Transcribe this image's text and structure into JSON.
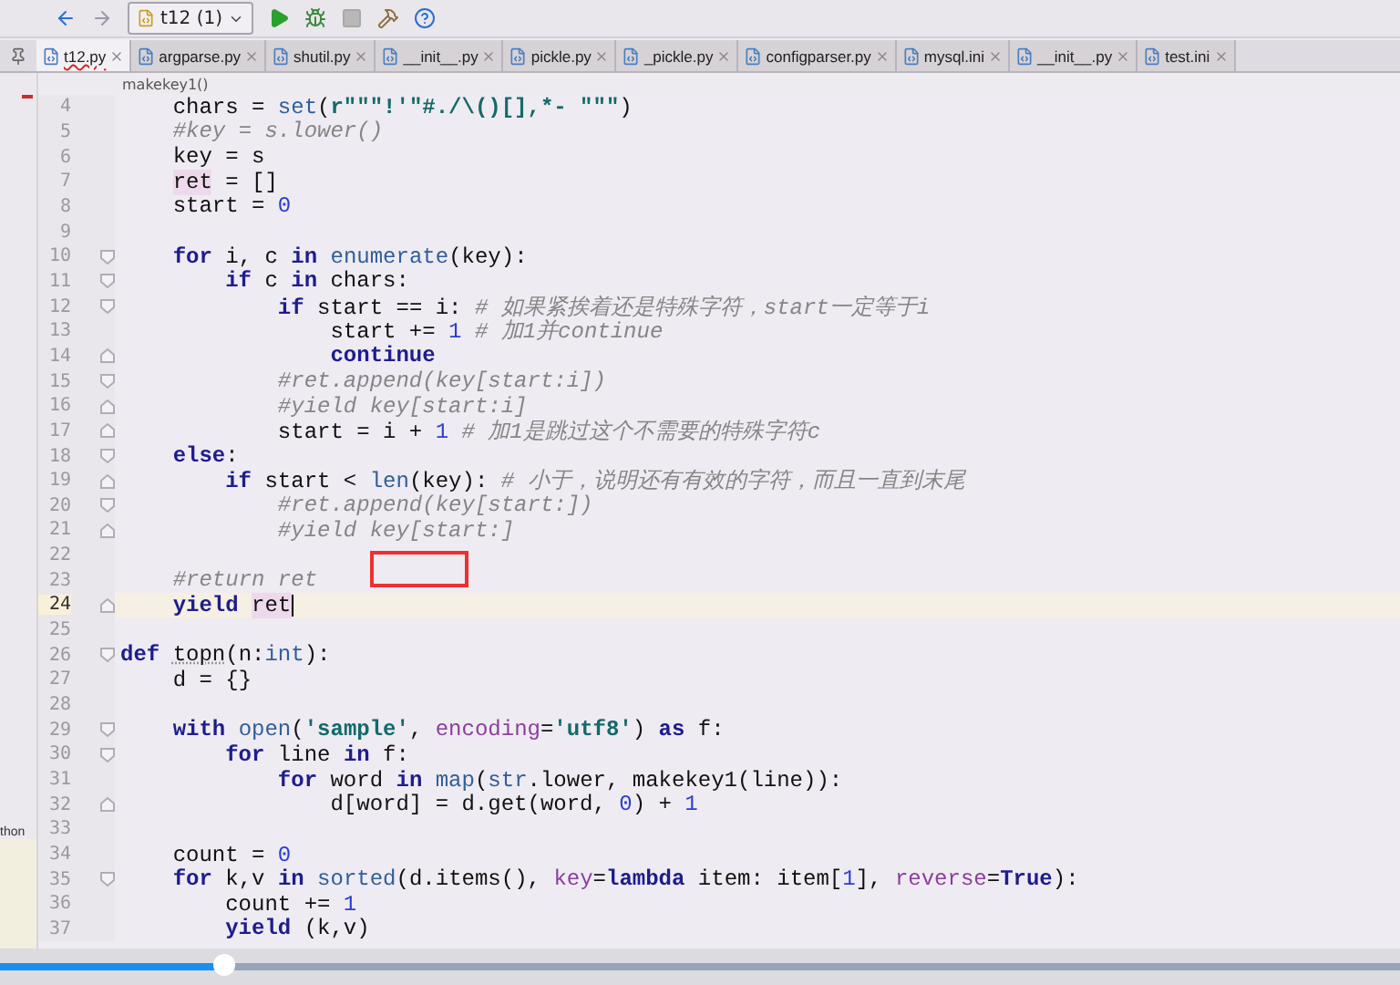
{
  "toolbar": {
    "run_config": "t12 (1)"
  },
  "tabs": [
    {
      "label": "t12.py",
      "selected": true,
      "error": true
    },
    {
      "label": "argparse.py",
      "selected": false,
      "error": false
    },
    {
      "label": "shutil.py",
      "selected": false,
      "error": false
    },
    {
      "label": "__init__.py",
      "selected": false,
      "error": false
    },
    {
      "label": "pickle.py",
      "selected": false,
      "error": false
    },
    {
      "label": "_pickle.py",
      "selected": false,
      "error": false
    },
    {
      "label": "configparser.py",
      "selected": false,
      "error": false
    },
    {
      "label": "mysql.ini",
      "selected": false,
      "error": false
    },
    {
      "label": "__init__.py",
      "selected": false,
      "error": false
    },
    {
      "label": "test.ini",
      "selected": false,
      "error": false
    }
  ],
  "breadcrumb": "makekey1()",
  "side_panel_fragment": "thon",
  "lines": [
    {
      "number": "4",
      "kind": "plain",
      "current": false,
      "tokens": [
        {
          "kind": "plain",
          "text": "    chars = "
        },
        {
          "kind": "builtin",
          "text": "set"
        },
        {
          "kind": "plain",
          "text": "("
        },
        {
          "kind": "str",
          "text": "r\"\"\"!'\"#./\\()[],*- \"\"\""
        },
        {
          "kind": "plain",
          "text": ")"
        }
      ]
    },
    {
      "number": "5",
      "kind": "plain",
      "current": false,
      "tokens": [
        {
          "kind": "cmt",
          "text": "    #key = s.lower()"
        }
      ]
    },
    {
      "number": "6",
      "kind": "plain",
      "current": false,
      "tokens": [
        {
          "kind": "plain",
          "text": "    key = s"
        }
      ]
    },
    {
      "number": "7",
      "kind": "plain",
      "current": false,
      "tokens": [
        {
          "kind": "ref",
          "text": "    ret"
        },
        {
          "kind": "plain",
          "text": " = []"
        }
      ]
    },
    {
      "number": "8",
      "kind": "plain",
      "current": false,
      "tokens": [
        {
          "kind": "plain",
          "text": "    start = "
        },
        {
          "kind": "num",
          "text": "0"
        }
      ]
    },
    {
      "number": "9",
      "kind": "plain",
      "current": false
    },
    {
      "number": "10",
      "kind": "fold-start",
      "current": false,
      "tokens": [
        {
          "kind": "kw",
          "text": "    for"
        },
        {
          "kind": "plain",
          "text": " i, c "
        },
        {
          "kind": "kw",
          "text": "in"
        },
        {
          "kind": "builtin",
          "text": " enumerate"
        },
        {
          "kind": "plain",
          "text": "(key):"
        }
      ]
    },
    {
      "number": "11",
      "kind": "fold-start",
      "current": false,
      "tokens": [
        {
          "kind": "kw",
          "text": "        if"
        },
        {
          "kind": "plain",
          "text": " c "
        },
        {
          "kind": "kw",
          "text": "in"
        },
        {
          "kind": "plain",
          "text": " chars:"
        }
      ]
    },
    {
      "number": "12",
      "kind": "fold-start",
      "current": false,
      "tokens": [
        {
          "kind": "kw",
          "text": "            if"
        },
        {
          "kind": "plain",
          "text": " start == i: "
        },
        {
          "kind": "cmt",
          "text": "# 如果紧挨着还是特殊字符，start一定等于i"
        }
      ]
    },
    {
      "number": "13",
      "kind": "plain",
      "current": false,
      "tokens": [
        {
          "kind": "plain",
          "text": "                start += "
        },
        {
          "kind": "num",
          "text": "1"
        },
        {
          "kind": "cmt",
          "text": " # 加1并continue"
        }
      ]
    },
    {
      "number": "14",
      "kind": "fold-end",
      "current": false,
      "tokens": [
        {
          "kind": "kw",
          "text": "                continue"
        }
      ]
    },
    {
      "number": "15",
      "kind": "fold-start",
      "current": false,
      "tokens": [
        {
          "kind": "cmt",
          "text": "            #ret.append(key[start:i])"
        }
      ]
    },
    {
      "number": "16",
      "kind": "fold-end",
      "current": false,
      "tokens": [
        {
          "kind": "cmt",
          "text": "            #yield key[start:i]"
        }
      ]
    },
    {
      "number": "17",
      "kind": "fold-end",
      "current": false,
      "tokens": [
        {
          "kind": "plain",
          "text": "            start = i + "
        },
        {
          "kind": "num",
          "text": "1"
        },
        {
          "kind": "cmt",
          "text": " # 加1是跳过这个不需要的特殊字符c"
        }
      ]
    },
    {
      "number": "18",
      "kind": "fold-start",
      "current": false,
      "tokens": [
        {
          "kind": "kw",
          "text": "    else"
        },
        {
          "kind": "plain",
          "text": ":"
        }
      ]
    },
    {
      "number": "19",
      "kind": "fold-end",
      "current": false,
      "tokens": [
        {
          "kind": "kw",
          "text": "        if"
        },
        {
          "kind": "plain",
          "text": " start < "
        },
        {
          "kind": "builtin",
          "text": "len"
        },
        {
          "kind": "plain",
          "text": "(key): "
        },
        {
          "kind": "cmt",
          "text": "# 小于，说明还有有效的字符，而且一直到末尾"
        }
      ]
    },
    {
      "number": "20",
      "kind": "fold-start",
      "current": false,
      "tokens": [
        {
          "kind": "cmt",
          "text": "            #ret.append(key[start:])"
        }
      ]
    },
    {
      "number": "21",
      "kind": "fold-end",
      "current": false,
      "tokens": [
        {
          "kind": "cmt",
          "text": "            #yield key[start:]"
        }
      ]
    },
    {
      "number": "22",
      "kind": "plain",
      "current": false
    },
    {
      "number": "23",
      "kind": "plain",
      "current": false,
      "tokens": [
        {
          "kind": "cmt",
          "text": "    #return ret"
        }
      ]
    },
    {
      "number": "24",
      "kind": "fold-end",
      "current": true,
      "tokens": [
        {
          "kind": "kw",
          "text": "    yield"
        },
        {
          "kind": "ref",
          "text": " ret"
        }
      ]
    },
    {
      "number": "25",
      "kind": "plain",
      "current": false
    },
    {
      "number": "26",
      "kind": "fold-start",
      "current": false,
      "tokens": [
        {
          "kind": "kw",
          "text": "def"
        },
        {
          "kind": "warn",
          "text": " topn"
        },
        {
          "kind": "plain",
          "text": "(n:"
        },
        {
          "kind": "builtin",
          "text": "int"
        },
        {
          "kind": "plain",
          "text": "):"
        }
      ]
    },
    {
      "number": "27",
      "kind": "plain",
      "current": false,
      "tokens": [
        {
          "kind": "plain",
          "text": "    d = {}"
        }
      ]
    },
    {
      "number": "28",
      "kind": "plain",
      "current": false
    },
    {
      "number": "29",
      "kind": "fold-start",
      "current": false,
      "tokens": [
        {
          "kind": "kw",
          "text": "    with"
        },
        {
          "kind": "builtin",
          "text": " open"
        },
        {
          "kind": "plain",
          "text": "("
        },
        {
          "kind": "str",
          "text": "'sample'"
        },
        {
          "kind": "plain",
          "text": ", "
        },
        {
          "kind": "param",
          "text": "encoding"
        },
        {
          "kind": "plain",
          "text": "="
        },
        {
          "kind": "str",
          "text": "'utf8'"
        },
        {
          "kind": "plain",
          "text": ") "
        },
        {
          "kind": "kw",
          "text": "as"
        },
        {
          "kind": "plain",
          "text": " f:"
        }
      ]
    },
    {
      "number": "30",
      "kind": "fold-start",
      "current": false,
      "tokens": [
        {
          "kind": "kw",
          "text": "        for"
        },
        {
          "kind": "plain",
          "text": " line "
        },
        {
          "kind": "kw",
          "text": "in"
        },
        {
          "kind": "plain",
          "text": " f:"
        }
      ]
    },
    {
      "number": "31",
      "kind": "plain",
      "current": false,
      "tokens": [
        {
          "kind": "kw",
          "text": "            for"
        },
        {
          "kind": "plain",
          "text": " word "
        },
        {
          "kind": "kw",
          "text": "in"
        },
        {
          "kind": "builtin",
          "text": " map"
        },
        {
          "kind": "plain",
          "text": "("
        },
        {
          "kind": "builtin",
          "text": "str"
        },
        {
          "kind": "plain",
          "text": ".lower, makekey1(line)):"
        }
      ]
    },
    {
      "number": "32",
      "kind": "fold-end",
      "current": false,
      "tokens": [
        {
          "kind": "plain",
          "text": "                d[word] = d.get(word, "
        },
        {
          "kind": "num",
          "text": "0"
        },
        {
          "kind": "plain",
          "text": ") + "
        },
        {
          "kind": "num",
          "text": "1"
        }
      ]
    },
    {
      "number": "33",
      "kind": "plain",
      "current": false
    },
    {
      "number": "34",
      "kind": "plain",
      "current": false,
      "tokens": [
        {
          "kind": "plain",
          "text": "    count = "
        },
        {
          "kind": "num",
          "text": "0"
        }
      ]
    },
    {
      "number": "35",
      "kind": "fold-start",
      "current": false,
      "tokens": [
        {
          "kind": "kw",
          "text": "    for"
        },
        {
          "kind": "plain",
          "text": " k,v "
        },
        {
          "kind": "kw",
          "text": "in"
        },
        {
          "kind": "builtin",
          "text": " sorted"
        },
        {
          "kind": "plain",
          "text": "(d.items(), "
        },
        {
          "kind": "param",
          "text": "key"
        },
        {
          "kind": "plain",
          "text": "="
        },
        {
          "kind": "kw",
          "text": "lambda"
        },
        {
          "kind": "plain",
          "text": " item: item["
        },
        {
          "kind": "num",
          "text": "1"
        },
        {
          "kind": "plain",
          "text": "], "
        },
        {
          "kind": "param",
          "text": "reverse"
        },
        {
          "kind": "plain",
          "text": "="
        },
        {
          "kind": "kw",
          "text": "True"
        },
        {
          "kind": "plain",
          "text": "):"
        }
      ]
    },
    {
      "number": "36",
      "kind": "plain",
      "current": false,
      "tokens": [
        {
          "kind": "plain",
          "text": "        count += "
        },
        {
          "kind": "num",
          "text": "1"
        }
      ]
    },
    {
      "number": "37",
      "kind": "plain",
      "current": false,
      "tokens": [
        {
          "kind": "kw",
          "text": "        yield"
        },
        {
          "kind": "plain",
          "text": " (k,v)"
        }
      ]
    }
  ],
  "video_player": {
    "level": 0.16
  }
}
